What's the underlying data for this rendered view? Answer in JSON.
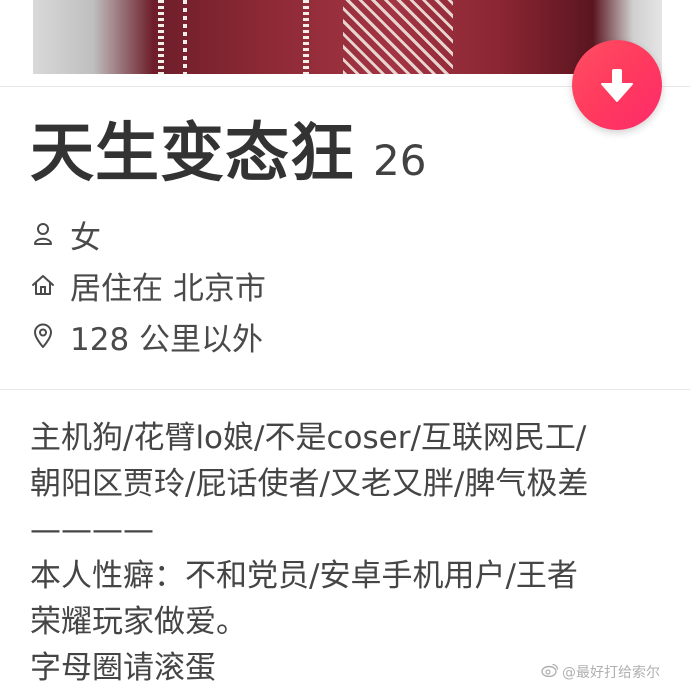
{
  "profile": {
    "name": "天生变态狂",
    "age": "26",
    "gender": "女",
    "residence": "居住在 北京市",
    "distance": "128 公里以外"
  },
  "bio": {
    "lines": [
      "主机狗/花臂lo娘/不是coser/互联网民工/",
      "朝阳区贾玲/屁话使者/又老又胖/脾气极差",
      "————",
      "本人性癖：不和党员/安卓手机用户/王者",
      "荣耀玩家做爱。",
      "字母圈请滚蛋"
    ]
  },
  "watermark": {
    "text": "@最好打给索尔"
  },
  "icons": {
    "action_button": "arrow-down-icon",
    "gender": "person-icon",
    "residence": "home-icon",
    "distance": "location-pin-icon",
    "watermark": "weibo-logo-icon"
  },
  "colors": {
    "accent_start": "#ff4f63",
    "accent_end": "#fd2a6a",
    "text_primary": "#333333",
    "text_secondary": "#4a4a4a"
  }
}
